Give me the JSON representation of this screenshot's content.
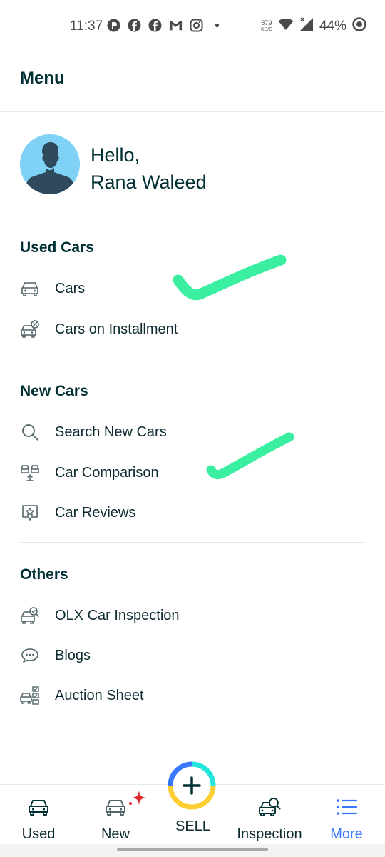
{
  "status_bar": {
    "time": "11:37",
    "speed_value": "879",
    "speed_unit": "KB/S",
    "battery": "44%"
  },
  "header": {
    "title": "Menu"
  },
  "profile": {
    "greeting": "Hello,",
    "name": "Rana Waleed"
  },
  "sections": {
    "used_cars": {
      "title": "Used Cars",
      "items": [
        {
          "label": "Cars",
          "icon": "car-icon"
        },
        {
          "label": "Cars on Installment",
          "icon": "car-installment-icon"
        }
      ]
    },
    "new_cars": {
      "title": "New Cars",
      "items": [
        {
          "label": "Search New Cars",
          "icon": "search-icon"
        },
        {
          "label": "Car Comparison",
          "icon": "car-comparison-icon"
        },
        {
          "label": "Car Reviews",
          "icon": "review-star-icon"
        }
      ]
    },
    "others": {
      "title": "Others",
      "items": [
        {
          "label": "OLX Car Inspection",
          "icon": "car-inspection-icon"
        },
        {
          "label": "Blogs",
          "icon": "chat-bubble-icon"
        },
        {
          "label": "Auction Sheet",
          "icon": "auction-sheet-icon"
        }
      ]
    }
  },
  "bottom_nav": {
    "used": "Used",
    "new": "New",
    "sell": "SELL",
    "inspection": "Inspection",
    "more": "More"
  },
  "colors": {
    "text": "#002f34",
    "active": "#3a77ff",
    "checkmark": "#3af0a0",
    "avatar_bg": "#7fd2f5",
    "new_badge": "#e0282e"
  }
}
